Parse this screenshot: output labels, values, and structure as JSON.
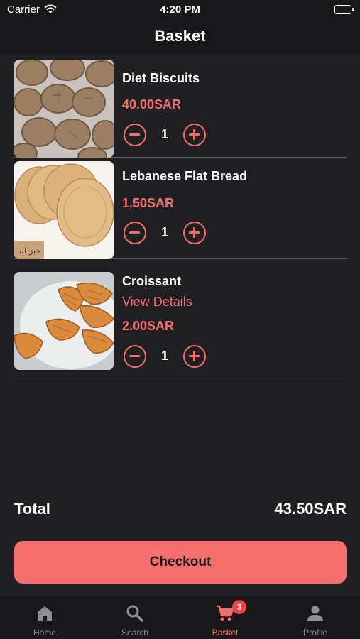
{
  "status_bar": {
    "carrier": "Carrier",
    "time": "4:20 PM"
  },
  "header": {
    "title": "Basket"
  },
  "items": [
    {
      "name": "Diet Biscuits",
      "price": "40.00SAR",
      "quantity": "1"
    },
    {
      "name": "Lebanese Flat Bread",
      "price": "1.50SAR",
      "quantity": "1",
      "image_label": "خبز لبنا"
    },
    {
      "name": "Croissant",
      "link": "View Details",
      "price": "2.00SAR",
      "quantity": "1"
    }
  ],
  "total": {
    "label": "Total",
    "amount": "43.50SAR"
  },
  "checkout": {
    "label": "Checkout"
  },
  "tab_bar": {
    "tabs": [
      {
        "label": "Home",
        "icon": "home-icon",
        "active": false
      },
      {
        "label": "Search",
        "icon": "search-icon",
        "active": false
      },
      {
        "label": "Basket",
        "icon": "cart-icon",
        "active": true,
        "badge": "3"
      },
      {
        "label": "Profile",
        "icon": "person-icon",
        "active": false
      }
    ]
  },
  "colors": {
    "accent": "#f56c6c",
    "background": "#202023",
    "bar_background": "#18181a",
    "checkout_button": "#f76e6e",
    "badge": "#f04040",
    "inactive_tab": "#8e8e92"
  }
}
